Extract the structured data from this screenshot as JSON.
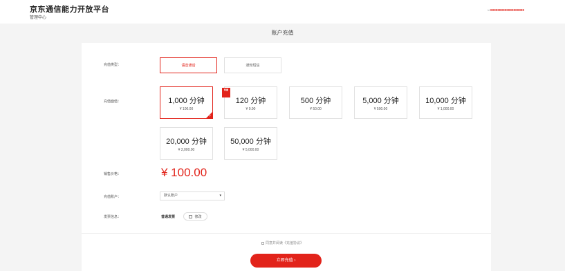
{
  "header": {
    "brand": "京东通信能力开放平台",
    "subtitle": "管理中心",
    "user_link": "xxxxxxxxxxxxxxxxxxx"
  },
  "page_title": "账户充值",
  "form": {
    "type_label": "充值类型：",
    "type_options": [
      {
        "label": "语音通话",
        "selected": true
      },
      {
        "label": "通知短信",
        "selected": false
      }
    ],
    "amount_label": "充值面值：",
    "amounts": [
      {
        "minutes": "1,000 分钟",
        "price": "¥ 100.00",
        "selected": true
      },
      {
        "minutes": "120 分钟",
        "price": "¥ 9.90",
        "selected": false,
        "hot_tag": "特惠"
      },
      {
        "minutes": "500 分钟",
        "price": "¥ 50.00",
        "selected": false
      },
      {
        "minutes": "5,000 分钟",
        "price": "¥ 500.00",
        "selected": false
      },
      {
        "minutes": "10,000 分钟",
        "price": "¥ 1,000.00",
        "selected": false
      },
      {
        "minutes": "20,000 分钟",
        "price": "¥ 2,000.00",
        "selected": false
      },
      {
        "minutes": "50,000 分钟",
        "price": "¥ 5,000.00",
        "selected": false
      }
    ],
    "sale_label": "销售价格：",
    "sale_price": "¥ 100.00",
    "account_label": "充值账户：",
    "account_value": "默认账户",
    "invoice_label": "发票信息：",
    "invoice_type": "普通发票",
    "invoice_option": "修改"
  },
  "agreement": "同意并阅读《充值协议》",
  "submit_label": "立即充值 ›",
  "colors": {
    "accent": "#e2231a"
  }
}
